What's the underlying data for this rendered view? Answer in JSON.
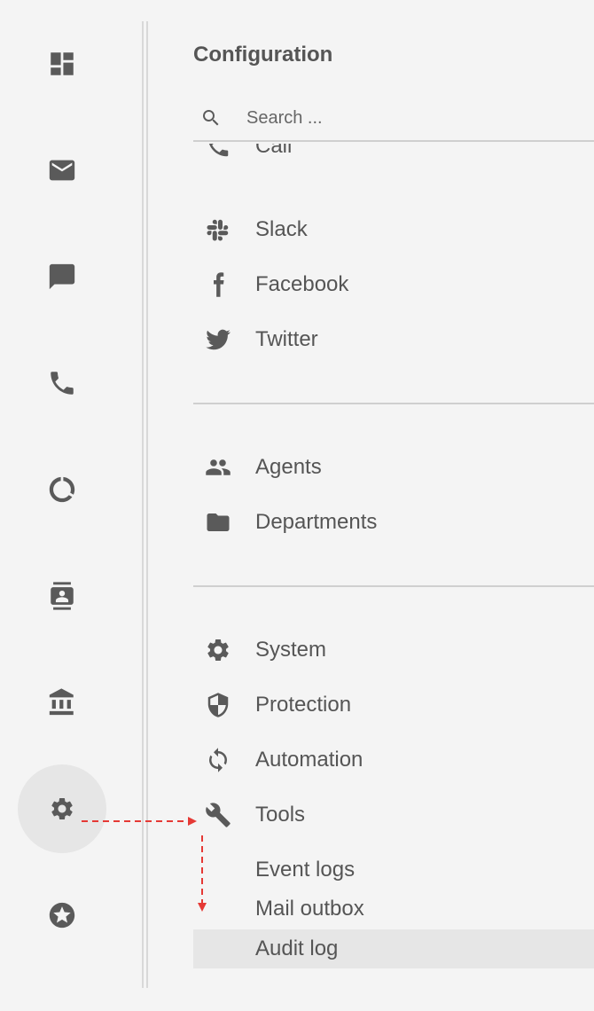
{
  "rail": {
    "items": [
      {
        "icon": "dashboard-icon"
      },
      {
        "icon": "mail-icon"
      },
      {
        "icon": "chat-icon"
      },
      {
        "icon": "phone-icon"
      },
      {
        "icon": "donut-chart-icon"
      },
      {
        "icon": "contacts-icon"
      },
      {
        "icon": "bank-icon"
      },
      {
        "icon": "settings-icon",
        "active": true
      },
      {
        "icon": "star-badge-icon"
      }
    ]
  },
  "panel": {
    "title": "Configuration",
    "search": {
      "placeholder": "Search ..."
    },
    "channels": [
      {
        "label": "Call",
        "icon": "call-icon"
      },
      {
        "label": "Slack",
        "icon": "slack-icon"
      },
      {
        "label": "Facebook",
        "icon": "facebook-icon"
      },
      {
        "label": "Twitter",
        "icon": "twitter-icon"
      }
    ],
    "team": [
      {
        "label": "Agents",
        "icon": "people-icon"
      },
      {
        "label": "Departments",
        "icon": "folder-icon"
      }
    ],
    "settings": [
      {
        "label": "System",
        "icon": "gear-icon"
      },
      {
        "label": "Protection",
        "icon": "shield-icon"
      },
      {
        "label": "Automation",
        "icon": "sync-icon"
      },
      {
        "label": "Tools",
        "icon": "wrench-icon"
      }
    ],
    "tools_sub": [
      {
        "label": "Event logs"
      },
      {
        "label": "Mail outbox"
      },
      {
        "label": "Audit log",
        "selected": true
      }
    ]
  },
  "colors": {
    "background": "#f4f4f4",
    "icon": "#5a5a5a",
    "text": "#555555",
    "selected_bg": "#e6e6e6",
    "annotation_arrow": "#e53935"
  }
}
